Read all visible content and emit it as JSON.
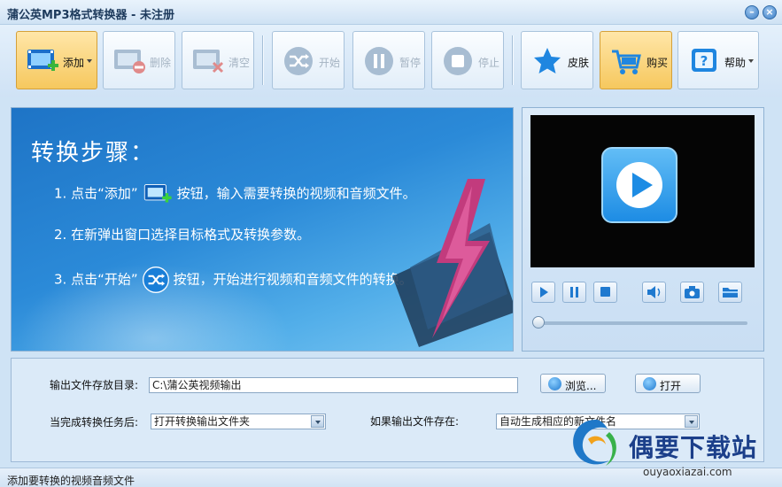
{
  "window": {
    "title": "蒲公英MP3格式转换器 - 未注册"
  },
  "toolbar": {
    "add": "添加",
    "delete": "删除",
    "clear": "清空",
    "start": "开始",
    "pause": "暂停",
    "stop": "停止",
    "skin": "皮肤",
    "buy": "购买",
    "help": "帮助"
  },
  "banner": {
    "title": "转换步骤：",
    "step1_a": "1. 点击“添加”",
    "step1_b": "按钮，输入需要转换的视频和音频文件。",
    "step2": "2. 在新弹出窗口选择目标格式及转换参数。",
    "step3_a": "3. 点击“开始”",
    "step3_b": "按钮，开始进行视频和音频文件的转换。"
  },
  "settings": {
    "output_dir_label": "输出文件存放目录:",
    "output_dir_value": "C:\\蒲公英视频输出",
    "browse": "浏览...",
    "open": "打开",
    "after_label": "当完成转换任务后:",
    "after_value": "打开转换输出文件夹",
    "exists_label": "如果输出文件存在:",
    "exists_value": "自动生成相应的新文件名"
  },
  "status": {
    "text": "添加要转换的视频音频文件"
  },
  "watermark": {
    "cn": "偶要下载站",
    "en": "ouyaoxiazai.com"
  },
  "colors": {
    "accent": "#2b8ad8",
    "highlight": "#f6c85e",
    "background": "#cfe3f5"
  }
}
